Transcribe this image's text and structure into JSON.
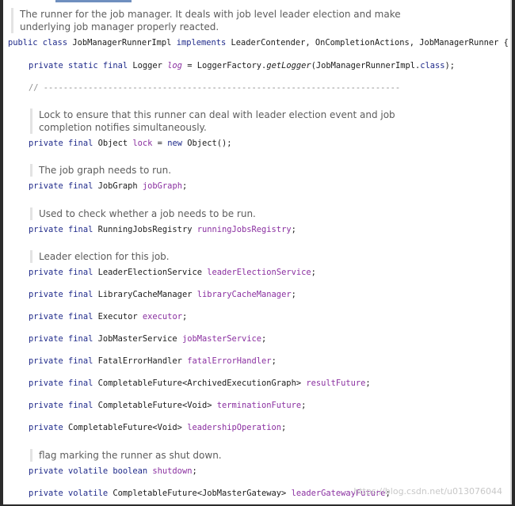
{
  "docs": {
    "class_doc_1": "The runner for the job manager. It deals with job level leader election and make",
    "class_doc_2": "underlying job manager properly reacted.",
    "lock_doc_1": "Lock to ensure that this runner can deal with leader election event and job",
    "lock_doc_2": "completion notifies simultaneously.",
    "jobgraph_doc": "The job graph needs to run.",
    "registry_doc": "Used to check whether a job needs to be run.",
    "election_doc": "Leader election for this job.",
    "shutdown_doc": "flag marking the runner as shut down."
  },
  "code": {
    "class_decl": {
      "kw1": "public class ",
      "name": "JobManagerRunnerImpl ",
      "kw2": "implements ",
      "rest": "LeaderContender, OnCompletionActions, JobManagerRunner {"
    },
    "logger": {
      "kw": "private static final ",
      "type": "Logger ",
      "field": "log",
      "eq": " = LoggerFactory.",
      "method": "getLogger",
      "arg1": "(JobManagerRunnerImpl.",
      "kw_class": "class",
      "arg2": ");"
    },
    "separator": "// ------------------------------------------------------------------------",
    "lock": {
      "kw": "private final ",
      "type": "Object ",
      "field": "lock",
      "eq": " = ",
      "kw_new": "new ",
      "rest": "Object();"
    },
    "jobgraph": {
      "kw": "private final ",
      "type": "JobGraph ",
      "field": "jobGraph",
      "semi": ";"
    },
    "registry": {
      "kw": "private final ",
      "type": "RunningJobsRegistry ",
      "field": "runningJobsRegistry",
      "semi": ";"
    },
    "election": {
      "kw": "private final ",
      "type": "LeaderElectionService ",
      "field": "leaderElectionService",
      "semi": ";"
    },
    "cache": {
      "kw": "private final ",
      "type": "LibraryCacheManager ",
      "field": "libraryCacheManager",
      "semi": ";"
    },
    "executor": {
      "kw": "private final ",
      "type": "Executor ",
      "field": "executor",
      "semi": ";"
    },
    "jobmaster": {
      "kw": "private final ",
      "type": "JobMasterService ",
      "field": "jobMasterService",
      "semi": ";"
    },
    "fatal": {
      "kw": "private final ",
      "type": "FatalErrorHandler ",
      "field": "fatalErrorHandler",
      "semi": ";"
    },
    "result": {
      "kw": "private final ",
      "type": "CompletableFuture<ArchivedExecutionGraph> ",
      "field": "resultFuture",
      "semi": ";"
    },
    "termination": {
      "kw": "private final ",
      "type": "CompletableFuture<Void> ",
      "field": "terminationFuture",
      "semi": ";"
    },
    "leadership": {
      "kw": "private ",
      "type": "CompletableFuture<Void> ",
      "field": "leadershipOperation",
      "semi": ";"
    },
    "shutdown": {
      "kw": "private volatile boolean ",
      "field": "shutdown",
      "semi": ";"
    },
    "gateway": {
      "kw": "private volatile ",
      "type": "CompletableFuture<JobMasterGateway> ",
      "field": "leaderGatewayFuture",
      "semi": ";"
    }
  },
  "watermark": "https://blog.csdn.net/u013076044"
}
